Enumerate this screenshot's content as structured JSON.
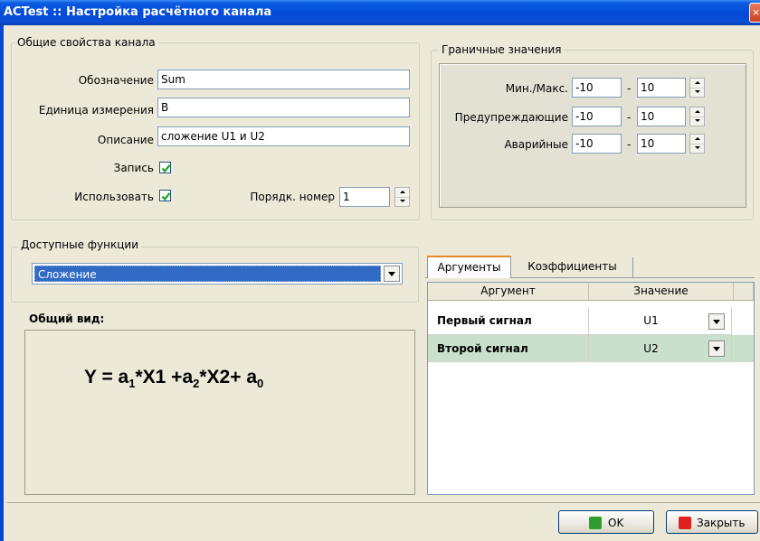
{
  "window": {
    "title": "ACTest :: Настройка расчётного канала",
    "close_glyph": "×"
  },
  "channel_props": {
    "title": "Общие свойства канала",
    "designation": {
      "label": "Обозначение",
      "value": "Sum"
    },
    "unit": {
      "label": "Единица измерения",
      "value": "В"
    },
    "description": {
      "label": "Описание",
      "value": "сложение U1 и U2"
    },
    "record": {
      "label": "Запись",
      "checked": true
    },
    "use": {
      "label": "Использовать",
      "checked": true
    },
    "order": {
      "label": "Порядк. номер",
      "value": "1"
    }
  },
  "limits": {
    "title": "Граничные значения",
    "rows": [
      {
        "label": "Мин./Макс.",
        "min": "-10",
        "dash": "-",
        "max": "10"
      },
      {
        "label": "Предупреждающие",
        "min": "-10",
        "dash": "-",
        "max": "10"
      },
      {
        "label": "Аварийные",
        "min": "-10",
        "dash": "-",
        "max": "10"
      }
    ]
  },
  "functions": {
    "title": "Доступные функции",
    "selected": "Сложение",
    "general_view_label": "Общий вид:",
    "formula": {
      "y": "Y = a",
      "s1": "1",
      "t1": "*X1 +a",
      "s2": "2",
      "t2": "*X2+ a",
      "s3": "0"
    }
  },
  "tabs": [
    {
      "label": "Аргументы",
      "active": true
    },
    {
      "label": "Коэффициенты",
      "active": false
    }
  ],
  "args_table": {
    "headers": [
      "Аргумент",
      "Значение"
    ],
    "rows": [
      {
        "argument": "Первый сигнал",
        "value": "U1"
      },
      {
        "argument": "Второй сигнал",
        "value": "U2"
      }
    ]
  },
  "buttons": {
    "ok": "OK",
    "close": "Закрыть"
  },
  "colors": {
    "title_bar": "#0449d8",
    "selection": "#316ac5",
    "row_highlight": "#c8e0cc",
    "ok_icon": "#2e9e2e",
    "close_icon": "#e02020"
  }
}
